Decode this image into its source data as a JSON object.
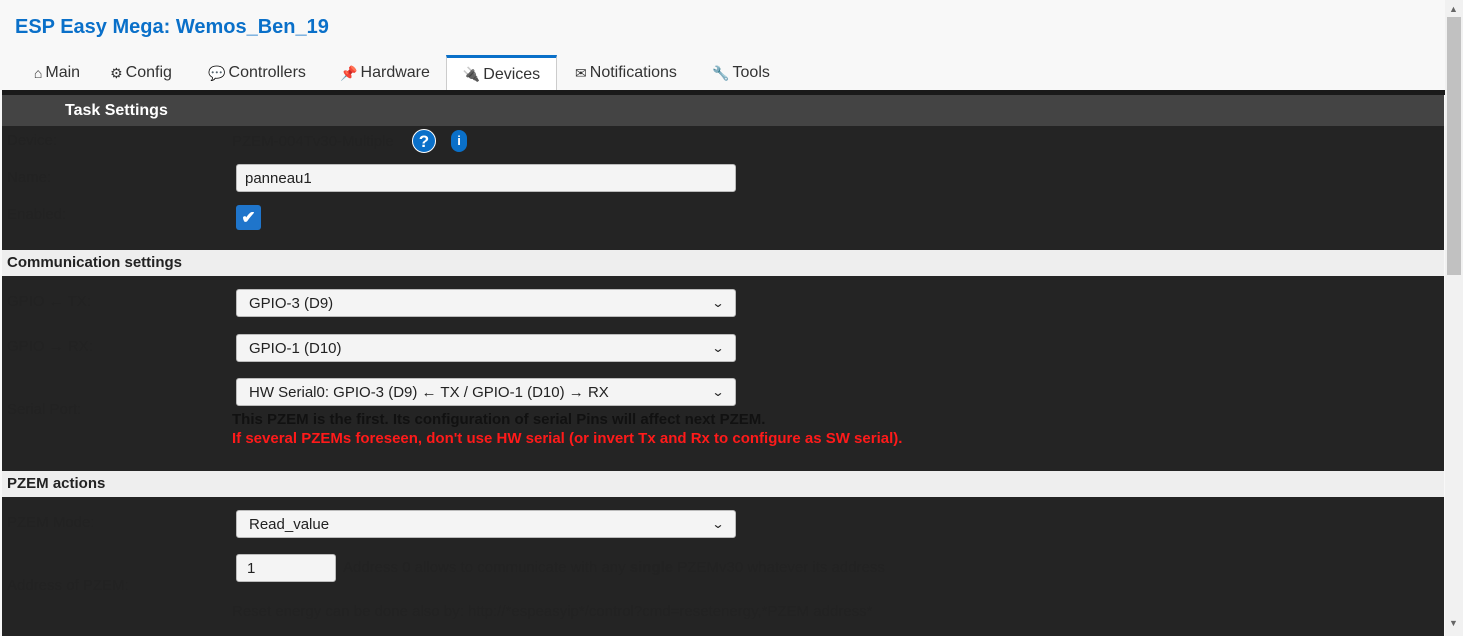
{
  "app": {
    "title": "ESP Easy Mega: Wemos_Ben_19"
  },
  "tabs": [
    {
      "icon": "⌂",
      "label": "Main"
    },
    {
      "icon": "⚙",
      "label": "Config"
    },
    {
      "icon": "💬",
      "label": "Controllers"
    },
    {
      "icon": "📌",
      "label": "Hardware"
    },
    {
      "icon": "🔌",
      "label": "Devices"
    },
    {
      "icon": "✉",
      "label": "Notifications"
    },
    {
      "icon": "🔧",
      "label": "Tools"
    }
  ],
  "active_tab": "Devices",
  "task_settings": {
    "header": "Task Settings",
    "device_label": "Device:",
    "device_value": "PZEM-004Tv30-Multiple",
    "help_icon": "?",
    "info_icon": "i",
    "name_label": "Name:",
    "name_value": "panneau1",
    "enabled_label": "Enabled:",
    "enabled_checked": true
  },
  "communication": {
    "header": "Communication settings",
    "gpio_tx_label": "GPIO ← TX:",
    "gpio_tx_value": "GPIO-3 (D9)",
    "gpio_rx_label": "GPIO → RX:",
    "gpio_rx_value": "GPIO-1 (D10)",
    "serial_port_label": "Serial Port:",
    "serial_port_value": "HW Serial0: GPIO-3 (D9) ← TX / GPIO-1 (D10) → RX",
    "note_black": "This PZEM is the first. Its configuration of serial Pins will affect next PZEM.",
    "note_red": "If several PZEMs foreseen, don't use HW serial (or invert Tx and Rx to configure as SW serial)."
  },
  "pzem_actions": {
    "header": "PZEM actions",
    "mode_label": "PZEM Mode:",
    "mode_value": "Read_value",
    "address_label": "Address of PZEM:",
    "address_value": "1",
    "address_hint_pre": "Address 0 allows to communicate with any ",
    "address_hint_bold": "single",
    "address_hint_post": " PZEMv30 whatever its address",
    "reset_hint": "Reset energy can be done also by: http://*espeasyip*/control?cmd=resetenergy,*PZEM address*"
  },
  "colors": {
    "accent": "#0a70c9",
    "warning": "#ff1a1a",
    "panel_bg": "#242424",
    "section_light_bg": "#eeeeee"
  }
}
